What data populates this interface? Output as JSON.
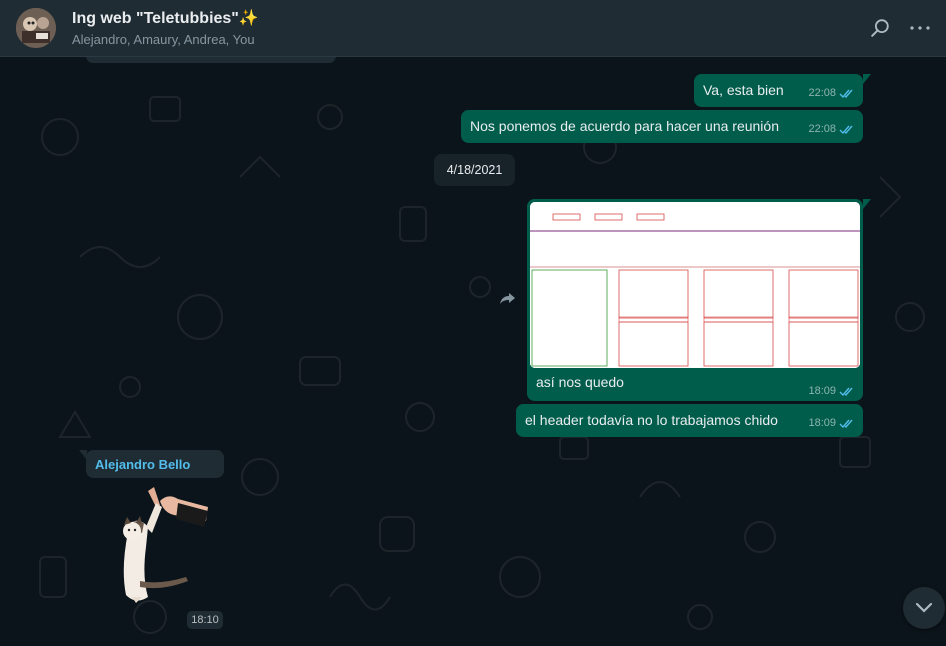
{
  "chat": {
    "title": "Ing web \"Teletubbies\"",
    "title_emoji": "✨",
    "participants": "Alejandro, Amaury, Andrea, You"
  },
  "messages": [
    {
      "text": "Va, esta bien",
      "time": "22:08",
      "status": "read"
    },
    {
      "text": "Nos ponemos de acuerdo para hacer una reunión",
      "time": "22:08",
      "status": "read"
    }
  ],
  "date_divider": "4/18/2021",
  "image_message": {
    "caption": "así nos quedo",
    "time": "18:09",
    "status": "read"
  },
  "message_after_image": {
    "text": "el header todavía no lo trabajamos chido",
    "time": "18:09",
    "status": "read"
  },
  "incoming": {
    "sender": "Alejandro Bello",
    "sticker_time": "18:10"
  },
  "colors": {
    "outgoing_bubble": "#005c4b",
    "incoming_bubble": "#1f2c34",
    "header_bg": "#202c33",
    "chat_bg": "#0b141a",
    "read_tick": "#53bdeb",
    "sender_name": "#53bdeb"
  },
  "icons": {
    "search": "search-icon",
    "menu": "more-options-icon",
    "forward": "forward-icon",
    "scroll": "chevron-down-icon",
    "read": "double-check-icon"
  }
}
